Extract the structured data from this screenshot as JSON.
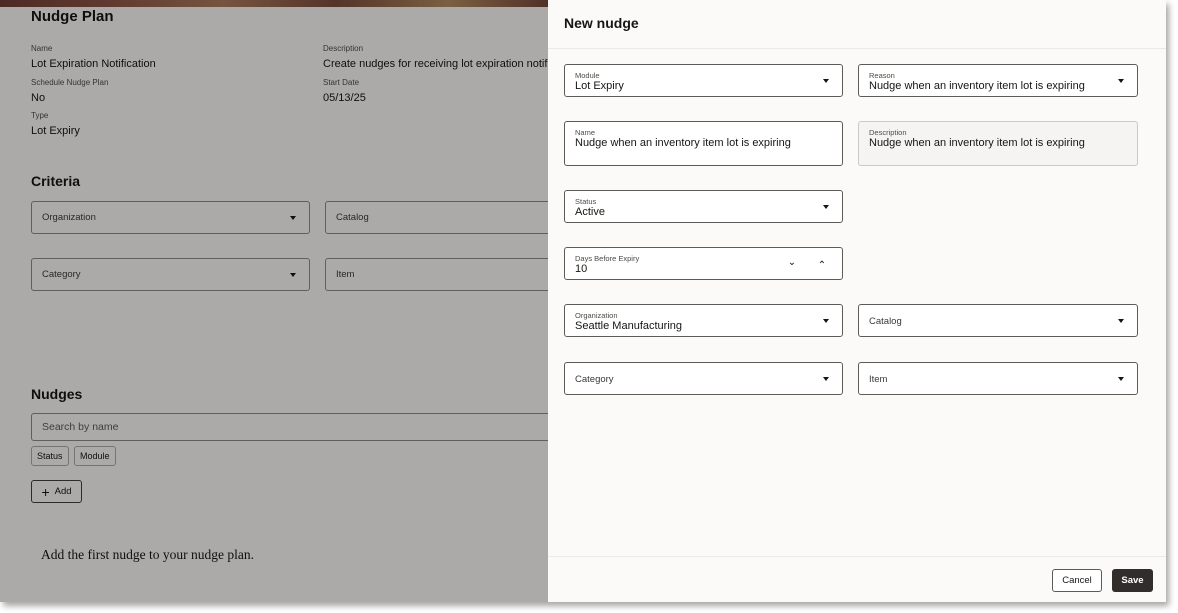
{
  "background": {
    "title": "Nudge Plan",
    "fields": {
      "name_label": "Name",
      "name_value": "Lot Expiration Notification",
      "description_label": "Description",
      "description_value": "Create nudges for receiving lot expiration notifica",
      "schedule_label": "Schedule Nudge Plan",
      "schedule_value": "No",
      "start_label": "Start Date",
      "start_value": "05/13/25",
      "type_label": "Type",
      "type_value": "Lot Expiry"
    },
    "criteria": {
      "title": "Criteria",
      "organization": "Organization",
      "catalog": "Catalog",
      "category": "Category",
      "item": "Item"
    },
    "nudges": {
      "title": "Nudges",
      "search_placeholder": "Search by name",
      "filter_status": "Status",
      "filter_module": "Module",
      "add_label": "Add",
      "empty_message": "Add the first nudge to your nudge plan."
    }
  },
  "drawer": {
    "title": "New nudge",
    "module": {
      "label": "Module",
      "value": "Lot Expiry"
    },
    "reason": {
      "label": "Reason",
      "value": "Nudge when an inventory item lot is expiring"
    },
    "name": {
      "label": "Name",
      "value": "Nudge when an inventory item lot is expiring"
    },
    "description": {
      "label": "Description",
      "value": "Nudge when an inventory item lot is expiring"
    },
    "status": {
      "label": "Status",
      "value": "Active"
    },
    "days_before_expiry": {
      "label": "Days Before Expiry",
      "value": "10"
    },
    "organization": {
      "label": "Organization",
      "value": "Seattle Manufacturing"
    },
    "catalog": {
      "placeholder": "Catalog"
    },
    "category": {
      "placeholder": "Category"
    },
    "item": {
      "placeholder": "Item"
    },
    "cancel_label": "Cancel",
    "save_label": "Save"
  }
}
